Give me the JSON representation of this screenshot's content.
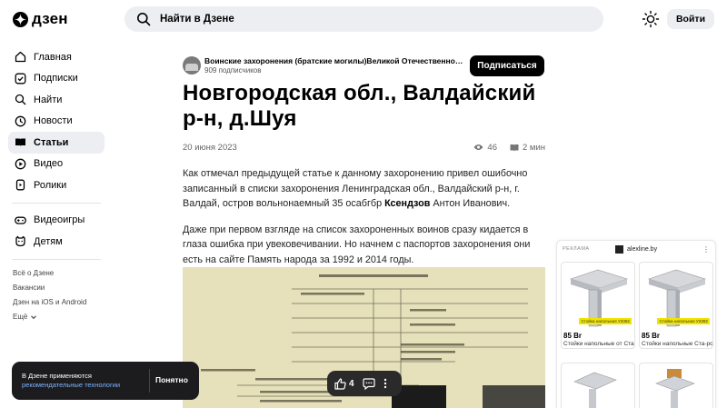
{
  "header": {
    "logo_text": "дзен",
    "search_placeholder": "Найти в Дзене",
    "login_label": "Войти"
  },
  "sidebar": {
    "items": [
      {
        "label": "Главная",
        "icon": "home-icon"
      },
      {
        "label": "Подписки",
        "icon": "subscriptions-icon"
      },
      {
        "label": "Найти",
        "icon": "search-icon"
      },
      {
        "label": "Новости",
        "icon": "news-icon"
      },
      {
        "label": "Статьи",
        "icon": "articles-icon",
        "active": true
      },
      {
        "label": "Видео",
        "icon": "video-icon"
      },
      {
        "label": "Ролики",
        "icon": "shorts-icon"
      }
    ],
    "items2": [
      {
        "label": "Видеоигры",
        "icon": "gamepad-icon"
      },
      {
        "label": "Детям",
        "icon": "kids-icon"
      }
    ],
    "footer": [
      "Всё о Дзене",
      "Вакансии",
      "Дзен на iOS и Android",
      "Ещё"
    ]
  },
  "article": {
    "channel_name": "Воинские захоронения (братские могилы)Великой Отечественной войны",
    "channel_subs": "909 подписчиков",
    "subscribe_label": "Подписаться",
    "title": "Новгородская обл., Валдайский р-н, д.Шуя",
    "date": "20 июня 2023",
    "views": "46",
    "read_time": "2 мин",
    "p1_before": "Как отмечал предыдущей статье к данному захоронению привел ошибочно записанный в списки захоронения Ленинградская обл., Валдайский р-н, г. Валдай, остров вольнонаемный 35 осабгбр ",
    "p1_bold": "Ксендзов",
    "p1_after": " Антон Иванович.",
    "p2": "Даже при первом взгляде на список захороненных воинов сразу кидается в глаза ошибка при увековечивании. Но начнем с паспортов захоронения они есть на сайте Память народа за 1992 и 2014 годы."
  },
  "reactions": {
    "likes": "4"
  },
  "cookie": {
    "text": "В Дзене применяются",
    "link": "рекомендательные технологии",
    "button": "Понятно"
  },
  "ad": {
    "label": "РЕКЛАМА",
    "brand": "alexline.by",
    "cards": [
      {
        "price": "85 Br",
        "desc": "Стойки напольные от Старооскольского за",
        "tag": "Стойка напольная У3392"
      },
      {
        "price": "85 Br",
        "desc": "Стойки напольные Ста-рооскольский завод",
        "tag": "Стойка напольная У3392"
      }
    ]
  }
}
